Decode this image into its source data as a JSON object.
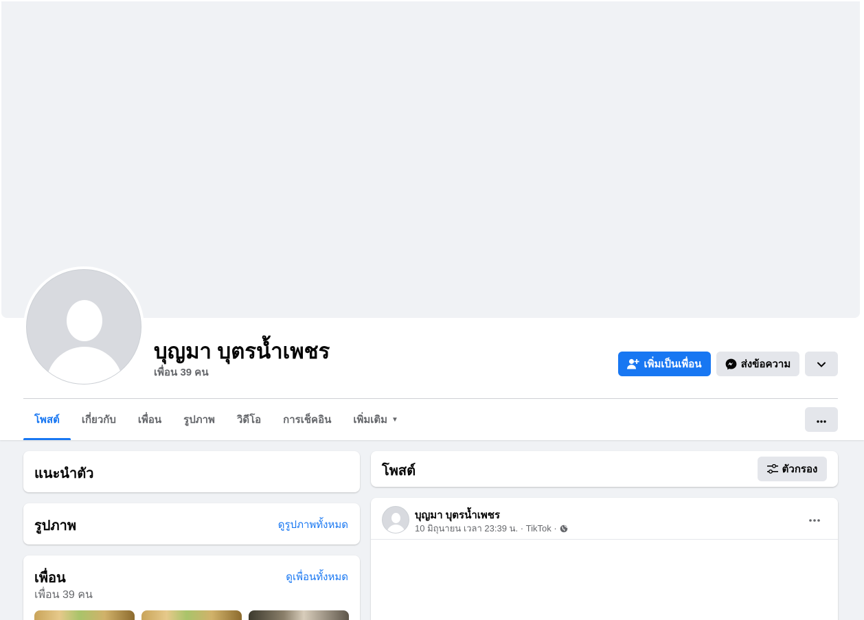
{
  "profile": {
    "name": "บุญมา บุตรน้ำเพชร",
    "friend_count": "เพื่อน 39 คน"
  },
  "actions": {
    "add_friend": "เพิ่มเป็นเพื่อน",
    "message": "ส่งข้อความ"
  },
  "tabs": [
    {
      "label": "โพสต์",
      "active": true
    },
    {
      "label": "เกี่ยวกับ"
    },
    {
      "label": "เพื่อน"
    },
    {
      "label": "รูปภาพ"
    },
    {
      "label": "วิดีโอ"
    },
    {
      "label": "การเช็คอิน"
    },
    {
      "label": "เพิ่มเติม"
    }
  ],
  "intro": {
    "title": "แนะนำตัว"
  },
  "photos": {
    "title": "รูปภาพ",
    "link": "ดูรูปภาพทั้งหมด"
  },
  "friends": {
    "title": "เพื่อน",
    "subtitle": "เพื่อน 39 คน",
    "link": "ดูเพื่อนทั้งหมด"
  },
  "posts": {
    "title": "โพสต์",
    "filter": "ตัวกรอง"
  },
  "post": {
    "author": "บุญมา บุตรน้ำเพชร",
    "meta": "10 มิถุนายน เวลา 23:39 น. · TikTok ·"
  },
  "colors": {
    "accent": "#1877f2",
    "background": "#f0f2f5",
    "secondary_button": "#e4e6eb"
  },
  "icons": {
    "add_friend": "person-plus-icon",
    "message": "messenger-icon",
    "dropdown": "chevron-down-icon",
    "more": "more-dots-icon",
    "filter": "sliders-icon",
    "audience": "globe-icon"
  }
}
